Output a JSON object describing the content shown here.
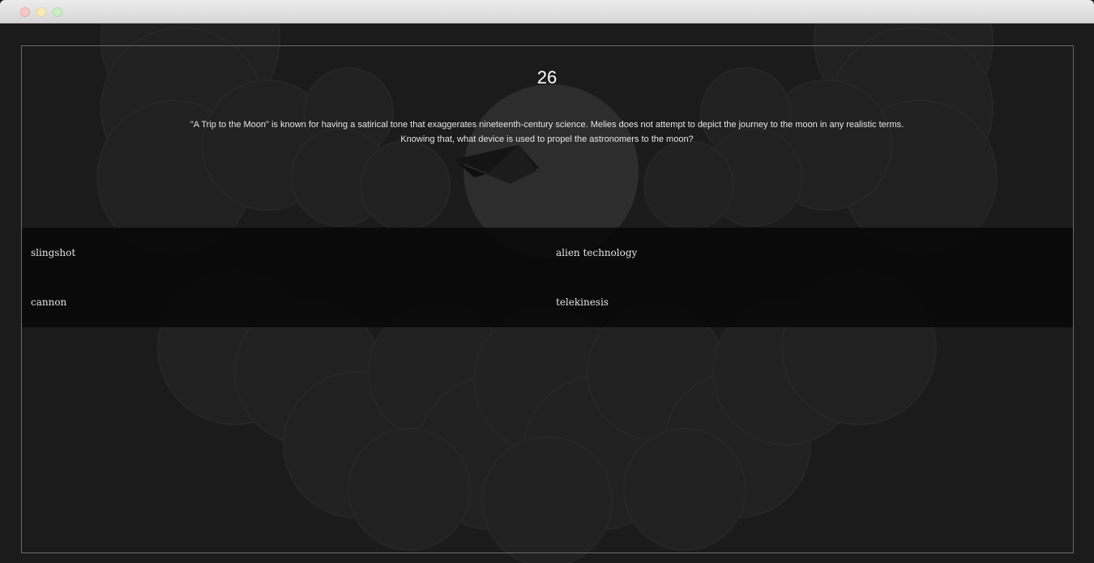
{
  "quiz": {
    "number": "26",
    "question_line1": "\"A Trip to the Moon\" is known for having a satirical tone that exaggerates nineteenth-century science. Melies does not attempt to depict the journey to the moon in any realistic terms.",
    "question_line2": "Knowing that, what device is used to propel the astronomers to the moon?",
    "answers": [
      "slingshot",
      "alien technology",
      "cannon",
      "telekinesis"
    ]
  },
  "colors": {
    "background": "#1b1b1b",
    "clouds": "#232323",
    "moon": "#2c2c2c",
    "frame_border": "#6a6a6a",
    "answer_band": "#080808"
  }
}
